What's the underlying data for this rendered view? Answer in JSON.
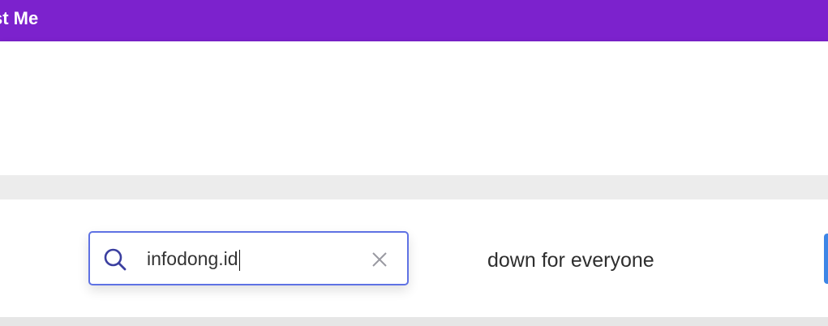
{
  "header": {
    "brand_text": "st Me",
    "bg_color": "#7c22cd"
  },
  "search": {
    "value": "infodong.id",
    "icon": "search-icon",
    "clear_icon": "close-icon",
    "border_color": "#5f72e4"
  },
  "status": {
    "text": "down for everyone"
  },
  "accent": {
    "button_color": "#3d86e6"
  }
}
